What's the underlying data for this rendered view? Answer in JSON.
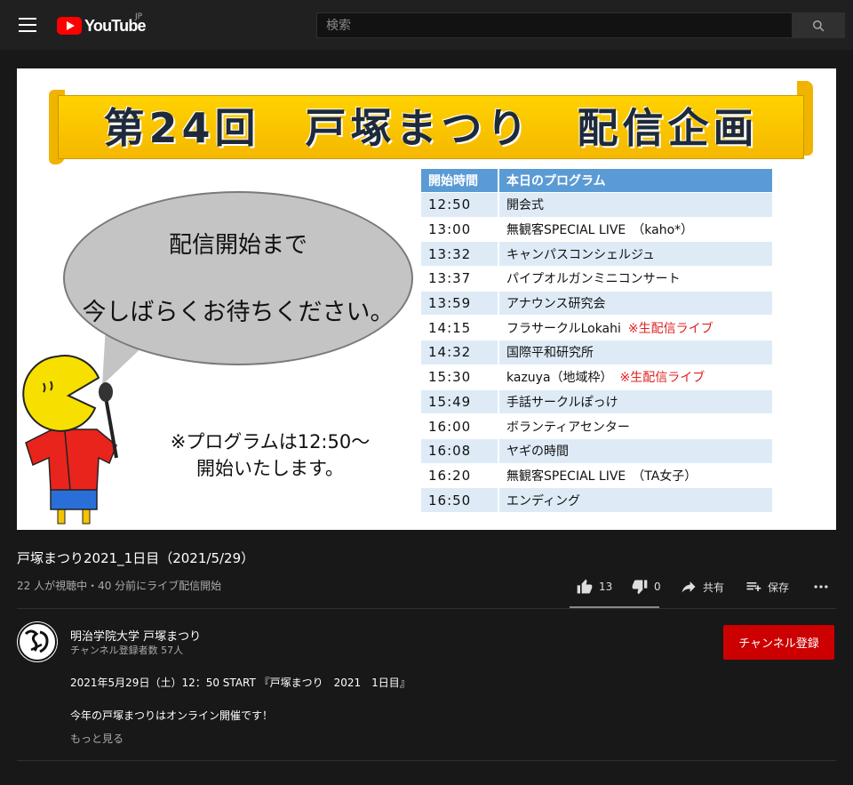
{
  "header": {
    "logo_text": "YouTube",
    "region": "JP",
    "search_placeholder": "検索"
  },
  "video": {
    "banner_title": "第24回　戸塚まつり　配信企画",
    "bubble_line1": "配信開始まで",
    "bubble_line2": "今しばらくお待ちください。",
    "note_line1": "※プログラムは12:50～",
    "note_line2": "開始いたします。",
    "schedule": {
      "header_time": "開始時間",
      "header_program": "本日のプログラム",
      "rows": [
        {
          "time": "12:50",
          "program": "開会式",
          "live": ""
        },
        {
          "time": "13:00",
          "program": "無観客SPECIAL LIVE　（kaho*）",
          "live": ""
        },
        {
          "time": "13:32",
          "program": "キャンパスコンシェルジュ",
          "live": ""
        },
        {
          "time": "13:37",
          "program": "パイプオルガンミニコンサート",
          "live": ""
        },
        {
          "time": "13:59",
          "program": "アナウンス研究会",
          "live": ""
        },
        {
          "time": "14:15",
          "program": "フラサークルLokahi",
          "live": "※生配信ライブ"
        },
        {
          "time": "14:32",
          "program": "国際平和研究所",
          "live": ""
        },
        {
          "time": "15:30",
          "program": "kazuya（地域枠）",
          "live": "※生配信ライブ"
        },
        {
          "time": "15:49",
          "program": "手話サークルぽっけ",
          "live": ""
        },
        {
          "time": "16:00",
          "program": "ボランティアセンター",
          "live": ""
        },
        {
          "time": "16:08",
          "program": "ヤギの時間",
          "live": ""
        },
        {
          "time": "16:20",
          "program": "無観客SPECIAL LIVE　（TA女子）",
          "live": ""
        },
        {
          "time": "16:50",
          "program": "エンディング",
          "live": ""
        }
      ]
    }
  },
  "info": {
    "title": "戸塚まつり2021_1日目（2021/5/29）",
    "meta": "22 人が視聴中・40 分前にライブ配信開始",
    "likes": "13",
    "dislikes": "0",
    "share_label": "共有",
    "save_label": "保存"
  },
  "channel": {
    "name": "明治学院大学 戸塚まつり",
    "subscribers": "チャンネル登録者数 57人",
    "subscribe_label": "チャンネル登録",
    "description_line1": "2021年5月29日（土）12：50 START 『戸塚まつり　2021　1日目』",
    "description_line2": "今年の戸塚まつりはオンライン開催です！",
    "show_more": "もっと見る"
  },
  "colors": {
    "page_bg": "#181818",
    "header_bg": "#202020",
    "brand_red": "#ff0000",
    "subscribe_red": "#cc0000",
    "banner_yellow": "#ffd200",
    "table_header_blue": "#5b9bd5",
    "table_row_blue": "#deebf7",
    "live_red": "#e02020"
  },
  "icons": {
    "menu": "hamburger-icon",
    "search": "search-icon",
    "like": "thumbs-up-icon",
    "dislike": "thumbs-down-icon",
    "share": "share-arrow-icon",
    "save": "playlist-add-icon",
    "more": "more-horiz-icon"
  }
}
